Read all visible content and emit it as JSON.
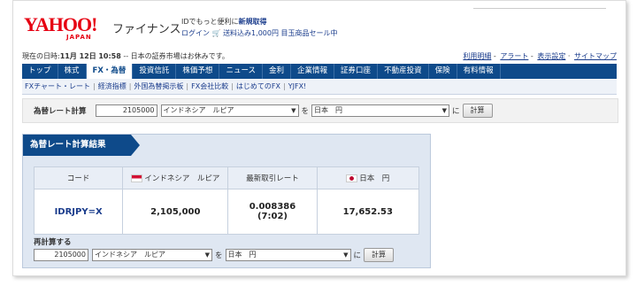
{
  "header": {
    "logo_text": "YAHOO!",
    "logo_sub": "JAPAN",
    "site_name": "ファイナンス",
    "promo_line1_prefix": "IDでもっと便利に",
    "promo_line1_link": "新規取得",
    "promo_line2_login": "ログイン",
    "promo_line2_cart_icon": "cart-icon",
    "promo_line2_text": "送料込み1,000円 目玉商品セール中"
  },
  "status": {
    "prefix": "現在の日時:",
    "date": "11月 12日",
    "time": "10:58",
    "suffix": " -- 日本の証券市場はお休みです。"
  },
  "top_links": [
    "利用明細",
    "アラート",
    "表示設定",
    "サイトマップ"
  ],
  "nav": {
    "items": [
      "トップ",
      "株式",
      "FX・為替",
      "投資信託",
      "株価予想",
      "ニュース",
      "金利",
      "企業情報",
      "証券口座",
      "不動産投資",
      "保険",
      "有料情報"
    ],
    "active_index": 2
  },
  "subnav": {
    "items": [
      "FXチャート・レート",
      "経済指標",
      "外国為替掲示板",
      "FX会社比較",
      "はじめてのFX",
      "YJFX!"
    ]
  },
  "calc": {
    "label": "為替レート計算",
    "amount": "2105000",
    "from_currency": "インドネシア　ルピア",
    "connector_wo": "を",
    "to_currency": "日本　円",
    "connector_ni": "に",
    "button": "計算"
  },
  "result": {
    "title": "為替レート計算結果",
    "headers": {
      "code": "コード",
      "from": "インドネシア　ルピア",
      "rate": "最新取引レート",
      "to": "日本　円"
    },
    "row": {
      "code": "IDRJPY=X",
      "from_value": "2,105,000",
      "rate": "0.008386",
      "rate_time": "(7:02)",
      "to_value": "17,652.53"
    },
    "recalc_label": "再計算する",
    "recalc_amount": "2105000",
    "recalc_from": "インドネシア　ルピア",
    "recalc_to": "日本　円",
    "recalc_button": "計算"
  }
}
